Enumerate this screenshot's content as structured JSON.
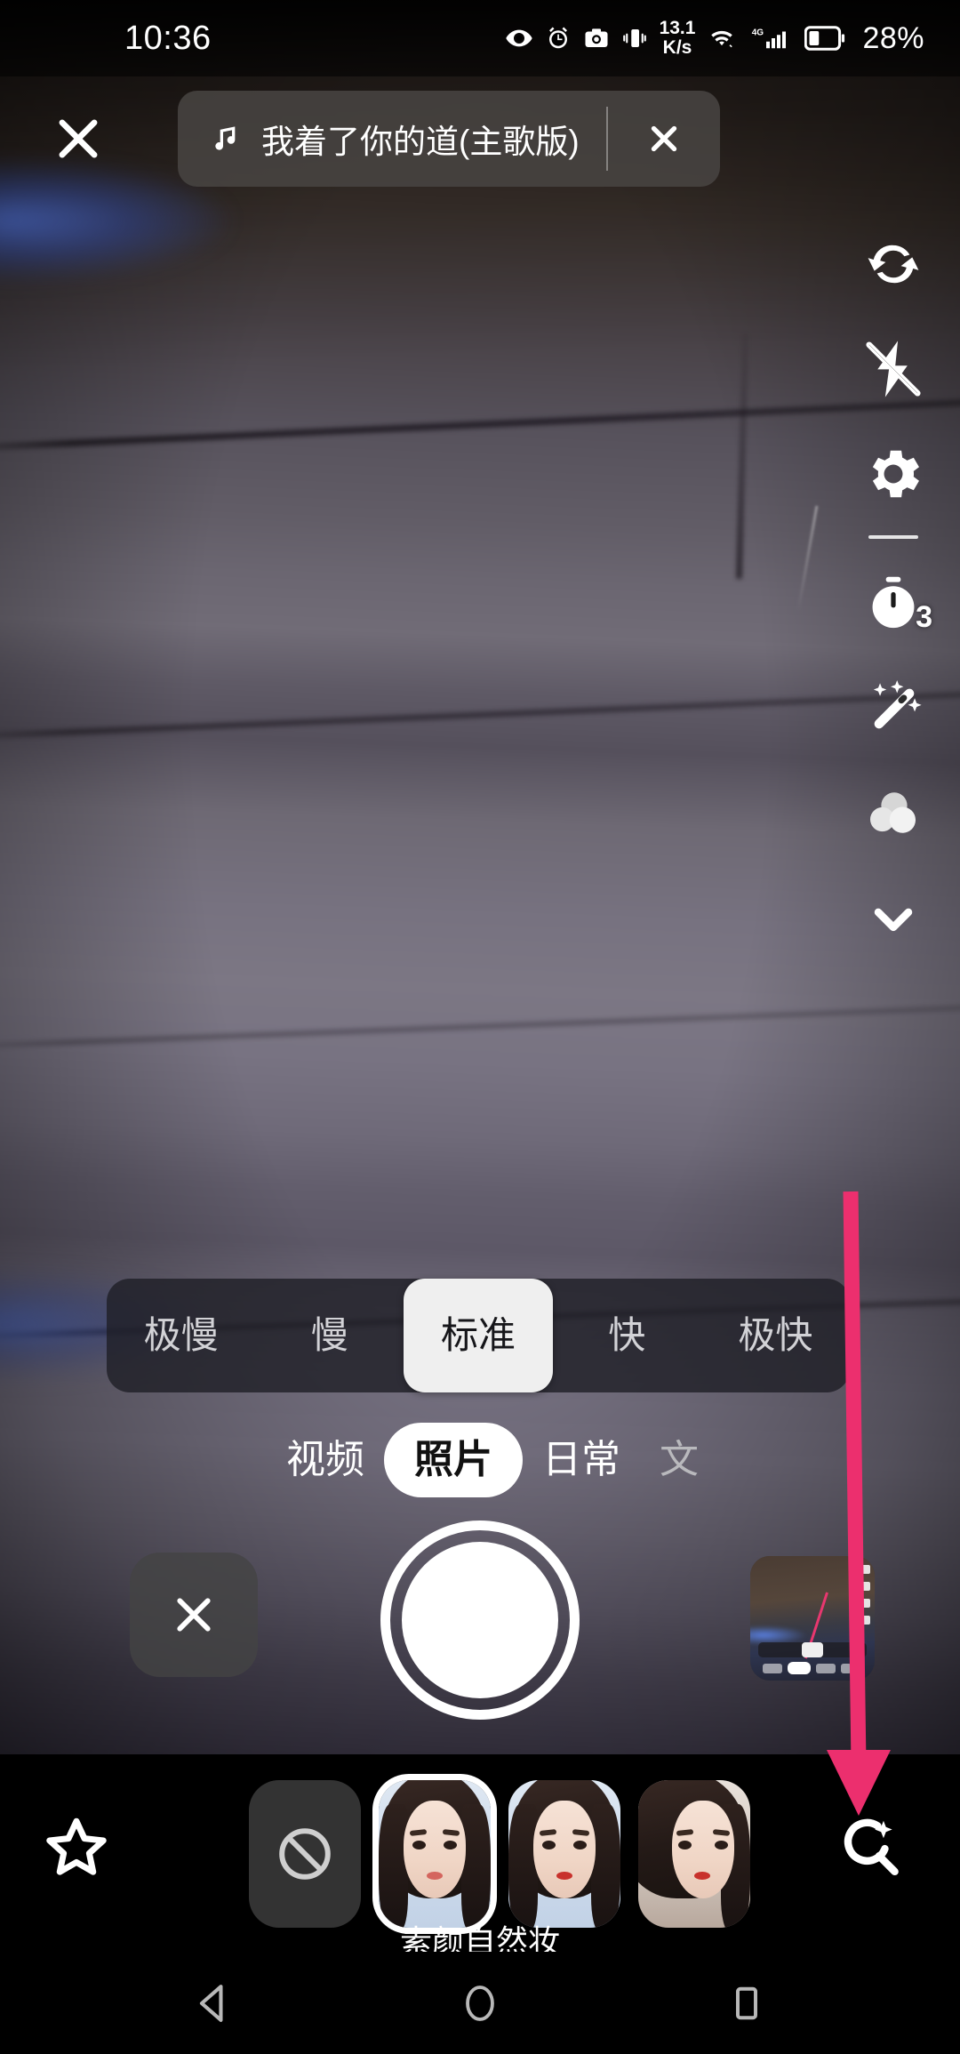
{
  "status_bar": {
    "time": "10:36",
    "network_speed": "13.1",
    "network_speed_unit": "K/s",
    "battery_percent": "28%",
    "network_type": "4G",
    "icons": [
      "eye-care-icon",
      "alarm-icon",
      "screenshot-icon",
      "vibrate-icon",
      "wifi-icon",
      "signal-icon",
      "battery-icon"
    ]
  },
  "top_bar": {
    "close_label": "✕",
    "music": {
      "note_icon": "music-note-icon",
      "title": "我着了你的道(主歌版)",
      "clear_label": "✕"
    }
  },
  "right_rail": {
    "items": [
      {
        "name": "flip-camera",
        "icon": "camera-flip-icon"
      },
      {
        "name": "flash-off",
        "icon": "flash-off-icon"
      },
      {
        "name": "settings",
        "icon": "gear-icon"
      },
      {
        "name": "timer",
        "icon": "timer-icon",
        "badge": "3"
      },
      {
        "name": "beautify",
        "icon": "magic-wand-icon"
      },
      {
        "name": "filters",
        "icon": "filter-circles-icon"
      },
      {
        "name": "collapse",
        "icon": "chevron-down-icon"
      }
    ]
  },
  "speed_selector": {
    "options": [
      "极慢",
      "慢",
      "标准",
      "快",
      "极快"
    ],
    "selected": "标准",
    "selected_index": 2
  },
  "mode_tabs": {
    "items": [
      "视频",
      "照片",
      "日常",
      "文"
    ],
    "selected": "照片",
    "selected_index": 1
  },
  "capture_row": {
    "cancel_label": "✕",
    "shutter_name": "shutter-button",
    "thumbnail_name": "last-capture-thumbnail"
  },
  "filter_strip": {
    "favorite_icon": "star-icon",
    "none_icon": "no-effect-icon",
    "items": [
      {
        "name": "none",
        "label": ""
      },
      {
        "name": "su-yan-zi-ran-zhuang",
        "label": "素颜自然妆",
        "selected": true
      },
      {
        "name": "filter-2",
        "label": ""
      },
      {
        "name": "filter-3",
        "label": ""
      }
    ],
    "selected_label": "素颜自然妆",
    "search_icon": "search-sparkle-icon"
  },
  "annotation": {
    "type": "arrow",
    "color": "#ec2f6e",
    "points_to": "search-sparkle-icon"
  },
  "nav_bar": {
    "back": "back-triangle-icon",
    "home": "home-circle-icon",
    "recents": "recents-square-icon"
  },
  "colors": {
    "accent_pink": "#ec2f6e",
    "selected_chip_bg": "#efefef",
    "panel_bg": "rgba(30,30,38,.80)",
    "strip_bg": "#000000"
  }
}
